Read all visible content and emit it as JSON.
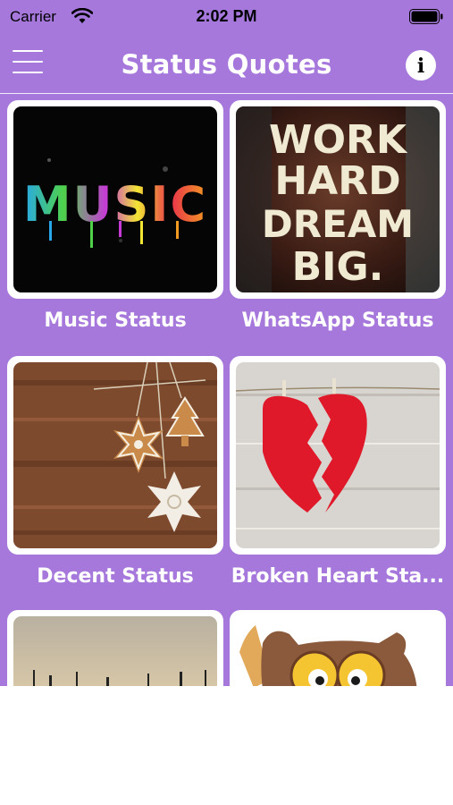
{
  "status_bar": {
    "carrier": "Carrier",
    "time": "2:02 PM"
  },
  "nav": {
    "title": "Status Quotes",
    "info_glyph": "i"
  },
  "colors": {
    "background": "#a678dc",
    "card": "#ffffff",
    "text": "#ffffff"
  },
  "categories": [
    {
      "label": "Music Status",
      "image_text": "MUSIC"
    },
    {
      "label": "WhatsApp Status",
      "image_text": [
        "WORK",
        "HARD",
        "DREAM",
        "BIG."
      ]
    },
    {
      "label": "Decent Status"
    },
    {
      "label": "Broken Heart Sta..."
    },
    {
      "label": ""
    },
    {
      "label": ""
    }
  ]
}
